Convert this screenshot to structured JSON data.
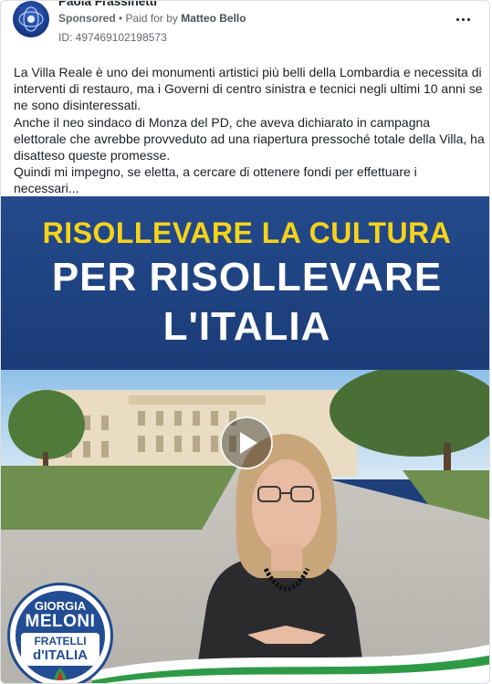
{
  "post": {
    "page_name": "Paola Frassinetti",
    "sponsored": "Sponsored",
    "separator": " • ",
    "paid_for_by": "Paid for by ",
    "sponsor_name": "Matteo Bello",
    "ad_id": "ID: 497469102198573",
    "more_icon": "more-horizontal-icon",
    "paragraphs": [
      "La Villa Reale è uno dei monumenti artistici più belli della Lombardia e necessita di interventi di restauro, ma i Governi di centro sinistra e tecnici negli ultimi 10 anni se ne sono disinteressati.",
      "Anche il neo sindaco di Monza del PD, che aveva dichiarato in campagna elettorale che avrebbe provveduto ad una riapertura pressoché totale della Villa, ha disatteso queste promesse.",
      "Quindi mi impegno, se eletta, a cercare di ottenere fondi per effettuare i necessari..."
    ]
  },
  "video": {
    "headline_yellow": "RISOLLEVARE LA CULTURA",
    "headline_white_1": "PER RISOLLEVARE",
    "headline_white_2": "L'ITALIA",
    "play_icon": "play-icon",
    "logo": {
      "line1": "GIORGIA",
      "line2": "MELONI",
      "line3": "FRATELLI",
      "line4": "d'ITALIA"
    },
    "colors": {
      "banner": "#1e3f7a",
      "yellow": "#f6d31a",
      "flag_green": "#2e9a45",
      "flag_red": "#d9262c"
    }
  }
}
